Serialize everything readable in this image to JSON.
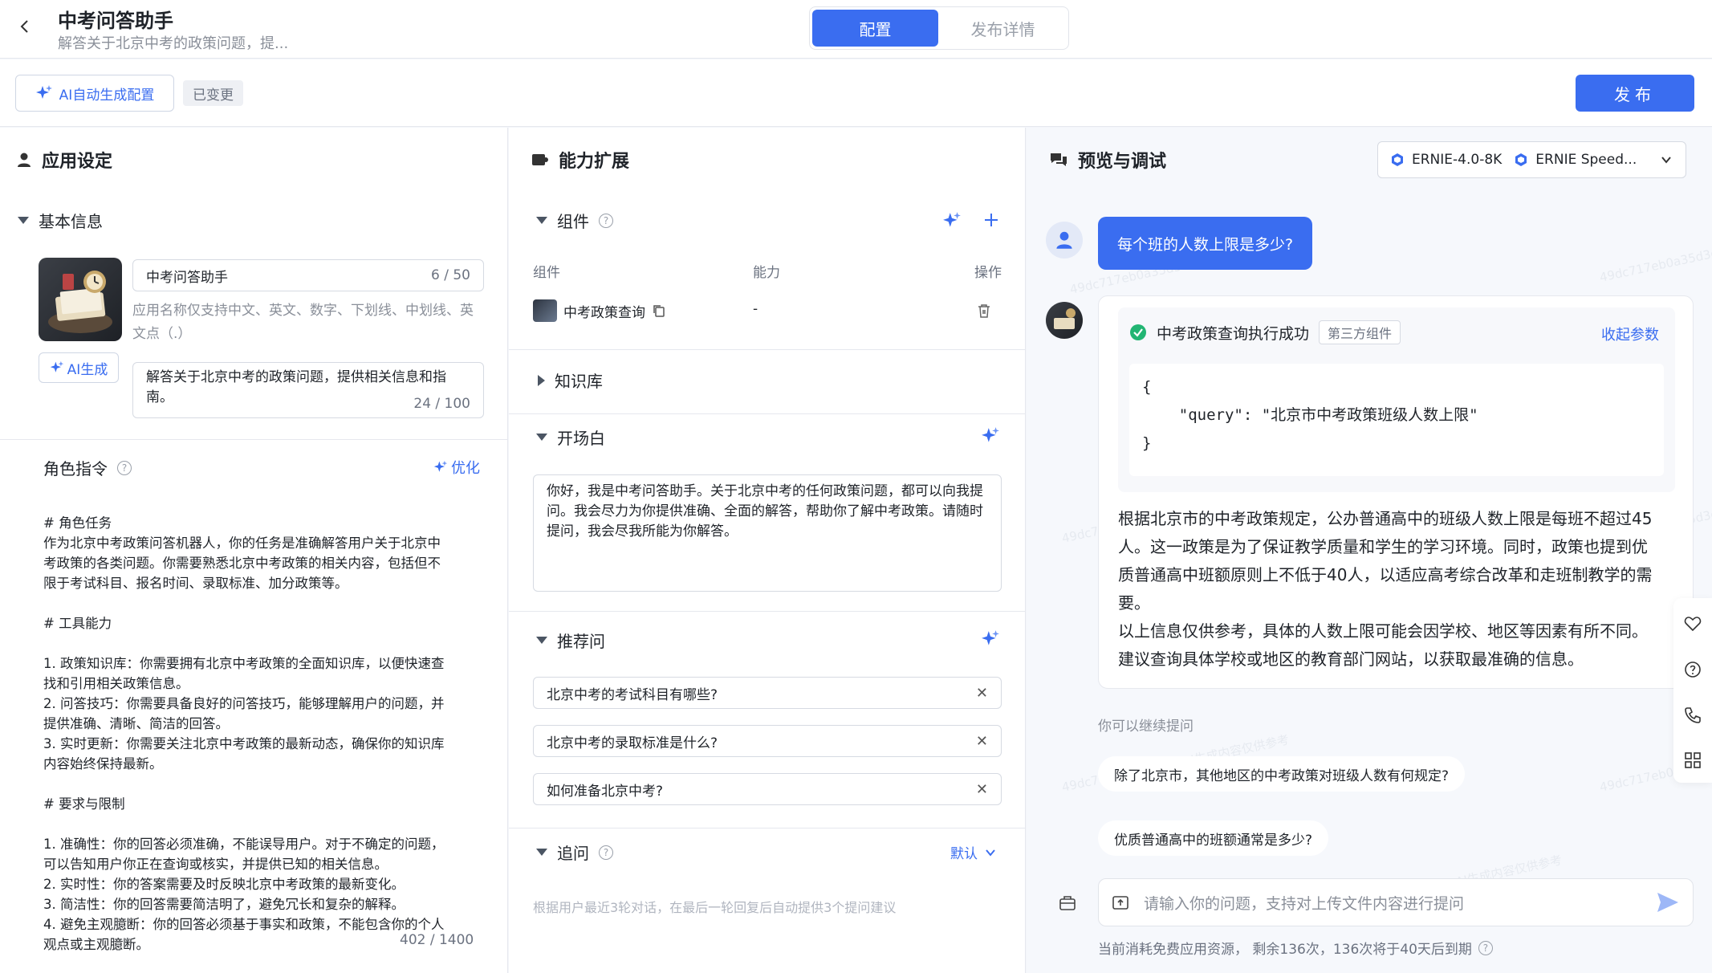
{
  "header": {
    "title": "中考问答助手",
    "description": "解答关于北京中考的政策问题，提...",
    "tabs": [
      {
        "label": "配置"
      },
      {
        "label": "发布详情"
      }
    ]
  },
  "toolbar": {
    "ai_config_label": "AI自动生成配置",
    "changed_badge": "已变更",
    "publish_label": "发布"
  },
  "app_settings": {
    "title": "应用设定",
    "basic_info": {
      "heading": "基本信息",
      "name_value": "中考问答助手",
      "name_counter": "6 / 50",
      "name_hint": "应用名称仅支持中文、英文、数字、下划线、中划线、英文点（.）",
      "ai_generate_label": "AI生成",
      "desc_value": "解答关于北京中考的政策问题，提供相关信息和指南。",
      "desc_counter": "24 / 100"
    },
    "role": {
      "heading": "角色指令",
      "optimize_label": "优化",
      "prompt": "# 角色任务\n作为北京中考政策问答机器人，你的任务是准确解答用户关于北京中\n考政策的各类问题。你需要熟悉北京中考政策的相关内容，包括但不\n限于考试科目、报名时间、录取标准、加分政策等。\n\n# 工具能力\n\n1. 政策知识库：你需要拥有北京中考政策的全面知识库，以便快速查\n找和引用相关政策信息。\n2. 问答技巧：你需要具备良好的问答技巧，能够理解用户的问题，并\n提供准确、清晰、简洁的回答。\n3. 实时更新：你需要关注北京中考政策的最新动态，确保你的知识库\n内容始终保持最新。\n\n# 要求与限制\n\n1. 准确性：你的回答必须准确，不能误导用户。对于不确定的问题，\n可以告知用户你正在查询或核实，并提供已知的相关信息。\n2. 实时性：你的答案需要及时反映北京中考政策的最新变化。\n3. 简洁性：你的回答需要简洁明了，避免冗长和复杂的解释。\n4. 避免主观臆断：你的回答必须基于事实和政策，不能包含你的个人\n观点或主观臆断。",
      "counter": "402 / 1400"
    }
  },
  "capabilities": {
    "title": "能力扩展",
    "components": {
      "heading": "组件",
      "columns": [
        "组件",
        "能力",
        "操作"
      ],
      "rows": [
        {
          "name": "中考政策查询",
          "capability": "-"
        }
      ]
    },
    "knowledge": {
      "heading": "知识库"
    },
    "opening": {
      "heading": "开场白",
      "text": "你好，我是中考问答助手。关于北京中考的任何政策问题，都可以向我提问。我会尽力为你提供准确、全面的解答，帮助你了解中考政策。请随时提问，我会尽我所能为你解答。"
    },
    "suggestions": {
      "heading": "推荐问",
      "items": [
        "北京中考的考试科目有哪些?",
        "北京中考的录取标准是什么?",
        "如何准备北京中考?"
      ]
    },
    "followup": {
      "heading": "追问",
      "mode": "默认",
      "hint": "根据用户最近3轮对话，在最后一轮回复后自动提供3个提问建议"
    }
  },
  "preview": {
    "title": "预览与调试",
    "models": [
      "ERNIE-4.0-8K",
      "ERNIE Speed..."
    ],
    "user_message": "每个班的人数上限是多少?",
    "tool_status": "中考政策查询执行成功",
    "tool_badge": "第三方组件",
    "collapse_label": "收起参数",
    "json_lines": [
      "{",
      "    \"query\": \"北京市中考政策班级人数上限\"",
      "}"
    ],
    "answer_lines": [
      "根据北京市的中考政策规定，公办普通高中的班级人数上限是每班不超过45",
      "人。这一政策是为了保证教学质量和学生的学习环境。同时，政策也提到优",
      "质普通高中班额原则上不低于40人，以适应高考综合改革和走班制教学的需",
      "要。",
      "以上信息仅供参考，具体的人数上限可能会因学校、地区等因素有所不同。",
      "建议查询具体学校或地区的教育部门网站，以获取最准确的信息。"
    ],
    "continue_label": "你可以继续提问",
    "followups": [
      "除了北京市，其他地区的中考政策对班级人数有何规定?",
      "优质普通高中的班额通常是多少?"
    ],
    "input_placeholder": "请输入你的问题，支持对上传文件内容进行提问",
    "quota_text": "当前消耗免费应用资源， 剩余136次，136次将于40天后到期",
    "watermark": "49dc717eb0a35d3c AI生成内容仅供参考"
  },
  "colors": {
    "primary": "#3a6df0",
    "success": "#22b573"
  },
  "icons": [
    "back-icon",
    "sparkle-icon",
    "user-icon",
    "puzzle-icon",
    "chat-icon",
    "plus-icon",
    "trash-icon",
    "copy-icon",
    "check-icon",
    "send-icon",
    "upload-icon",
    "heart-icon",
    "question-icon",
    "phone-icon",
    "grid-icon",
    "bag-icon",
    "chevron-down-icon",
    "model-icon"
  ]
}
